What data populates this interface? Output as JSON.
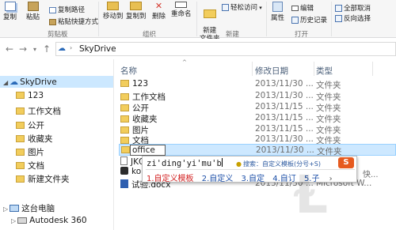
{
  "ribbon": {
    "clipboard": {
      "copy": "复制",
      "paste": "粘贴",
      "copy_path": "复制路径",
      "paste_shortcut": "粘贴快捷方式",
      "group": "剪贴板"
    },
    "organize": {
      "move_to": "移动到",
      "copy_to": "复制到",
      "delete": "删除",
      "rename": "重命名",
      "group": "组织"
    },
    "new": {
      "new_folder": "新建\n文件夹",
      "easy_access": "轻松访问",
      "group": "新建"
    },
    "open": {
      "properties": "属性",
      "edit": "编辑",
      "history": "历史记录",
      "group": "打开"
    },
    "select": {
      "select_all": "全部取消",
      "invert": "反向选择"
    }
  },
  "address": {
    "path": "SkyDrive"
  },
  "nav": {
    "root": "SkyDrive",
    "items": [
      "123",
      "工作文档",
      "公开",
      "收藏夹",
      "图片",
      "文档",
      "新建文件夹"
    ],
    "computer": "这台电脑",
    "autodesk": "Autodesk 360"
  },
  "columns": {
    "name": "名称",
    "modified": "修改日期",
    "type": "类型"
  },
  "files": [
    {
      "name": "123",
      "date": "2013/11/30 ...",
      "type": "文件夹"
    },
    {
      "name": "工作文档",
      "date": "2013/11/30 ...",
      "type": "文件夹"
    },
    {
      "name": "公开",
      "date": "2013/11/15 ...",
      "type": "文件夹"
    },
    {
      "name": "收藏夹",
      "date": "2013/11/15 ...",
      "type": "文件夹"
    },
    {
      "name": "图片",
      "date": "2013/11/15 ...",
      "type": "文件夹"
    },
    {
      "name": "文档",
      "date": "2013/11/30 ...",
      "type": "文件夹"
    },
    {
      "name": "office",
      "date": "2013/11/30 ...",
      "type": "文件夹"
    },
    {
      "name": "JKQD",
      "date": "",
      "type": ""
    },
    {
      "name": "kongj",
      "date": "",
      "type": ""
    },
    {
      "name": "试验.docx",
      "date": "2013/11/30 ...",
      "type": "Microsoft W..."
    }
  ],
  "ime": {
    "composition": "zi'ding'yi'mu'b",
    "search_hint": "搜索：自定义模板(分号+S)",
    "logo": "S",
    "candidates": [
      "1.自定义模板",
      "2.自定义",
      "3.自定",
      "4.自订",
      "5.子"
    ]
  },
  "side_truncated": [
    "快..."
  ]
}
